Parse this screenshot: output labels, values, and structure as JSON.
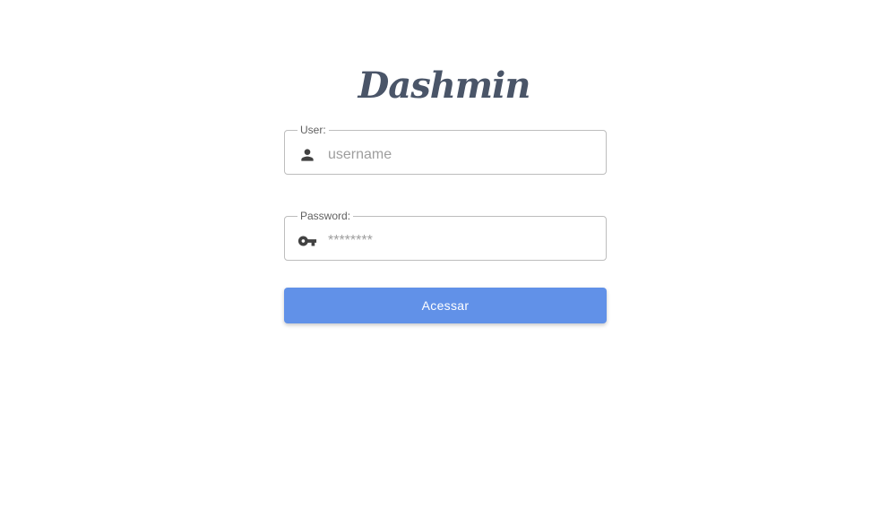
{
  "brand": {
    "logo_text": "Dashmin",
    "logo_color": "#4a5568"
  },
  "login_form": {
    "user_field": {
      "label": "User:",
      "placeholder": "username",
      "value": "",
      "icon": "person-icon"
    },
    "password_field": {
      "label": "Password:",
      "placeholder": "********",
      "value": "",
      "icon": "key-icon"
    },
    "submit_label": "Acessar",
    "accent_color": "#6191e8"
  }
}
